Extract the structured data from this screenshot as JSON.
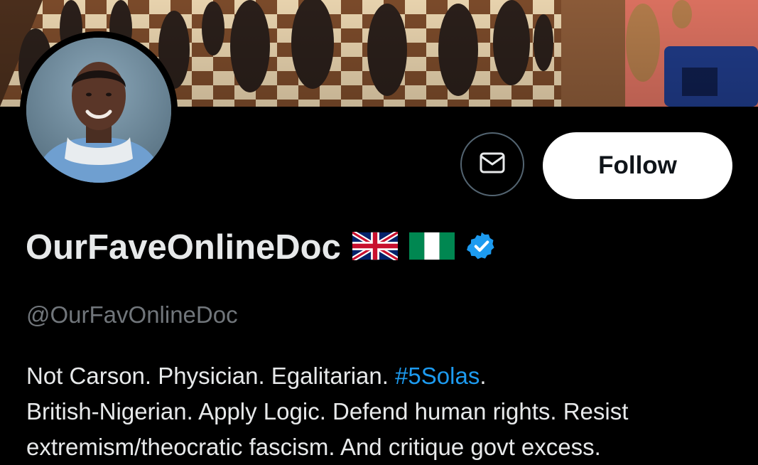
{
  "profile": {
    "display_name": "OurFaveOnlineDoc",
    "handle": "@OurFavOnlineDoc",
    "flags": [
      "uk-flag",
      "nigeria-flag"
    ],
    "verified_badge_color": "#1d9bf0"
  },
  "actions": {
    "message_icon": "envelope-icon",
    "follow_label": "Follow"
  },
  "bio": {
    "line1_before": "Not Carson. Physician. Egalitarian. ",
    "hashtag": "#5Solas",
    "line1_after": ".",
    "line2": "British-Nigerian. Apply Logic. Defend human rights. Resist",
    "line3": "extremism/theocratic fascism. And critique govt excess."
  },
  "colors": {
    "background": "#000000",
    "text": "#e7e9ea",
    "secondary_text": "#71767b",
    "link": "#1d9bf0",
    "button_bg": "#ffffff",
    "button_text": "#0f1419"
  }
}
